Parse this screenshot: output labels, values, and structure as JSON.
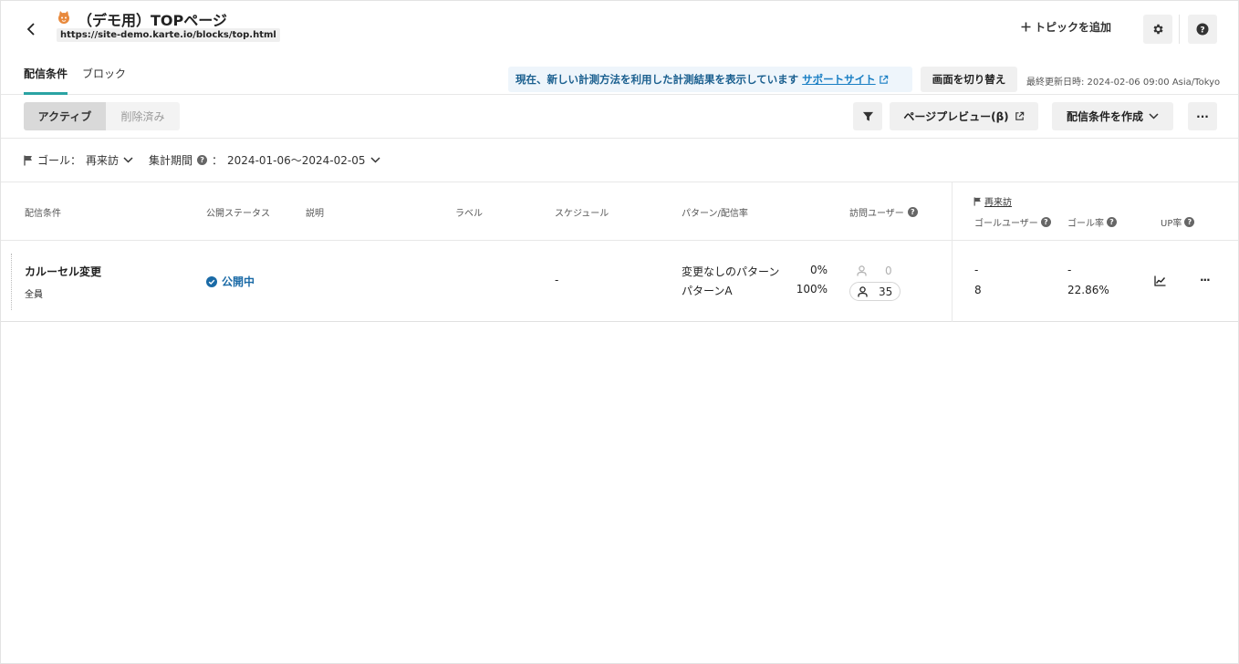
{
  "header": {
    "title": "（デモ用）TOPページ",
    "url": "https://site-demo.karte.io/blocks/top.html",
    "add_topic_label": "トピックを追加"
  },
  "tabs": [
    {
      "label": "配信条件",
      "active": true
    },
    {
      "label": "ブロック",
      "active": false
    }
  ],
  "notice": {
    "text": "現在、新しい計測方法を利用した計測結果を表示しています",
    "link_label": "サポートサイト"
  },
  "switch_view_label": "画面を切り替え",
  "last_updated": "最終更新日時: 2024-02-06 09:00 Asia/Tokyo",
  "toolbar": {
    "segments": [
      "アクティブ",
      "削除済み"
    ],
    "page_preview_label": "ページプレビュー(β)",
    "create_condition_label": "配信条件を作成",
    "more_label": "···"
  },
  "filters": {
    "goal_label": "ゴール：",
    "goal_value": "再来訪",
    "period_label": "集計期間",
    "period_sep": "：",
    "period_value": "2024-01-06〜2024-02-05"
  },
  "table": {
    "headers": {
      "condition": "配信条件",
      "status": "公開ステータス",
      "description": "説明",
      "label": "ラベル",
      "schedule": "スケジュール",
      "pattern": "パターン/配信率",
      "visitors": "訪問ユーザー",
      "goal_group": "再来訪",
      "goal_users": "ゴールユーザー",
      "goal_rate": "ゴール率",
      "up_rate": "UP率"
    },
    "rows": [
      {
        "name": "カルーセル変更",
        "target": "全員",
        "status": "公開中",
        "schedule": "-",
        "patterns": [
          {
            "name": "変更なしのパターン",
            "rate": "0%",
            "visitors": "0",
            "goal_users": "-",
            "goal_rate": "-"
          },
          {
            "name": "パターンA",
            "rate": "100%",
            "visitors": "35",
            "goal_users": "8",
            "goal_rate": "22.86%"
          }
        ]
      }
    ]
  },
  "colors": {
    "accent": "#2aa3a3",
    "status_blue": "#1a6aa6",
    "notice_bg": "#eef5fb"
  }
}
